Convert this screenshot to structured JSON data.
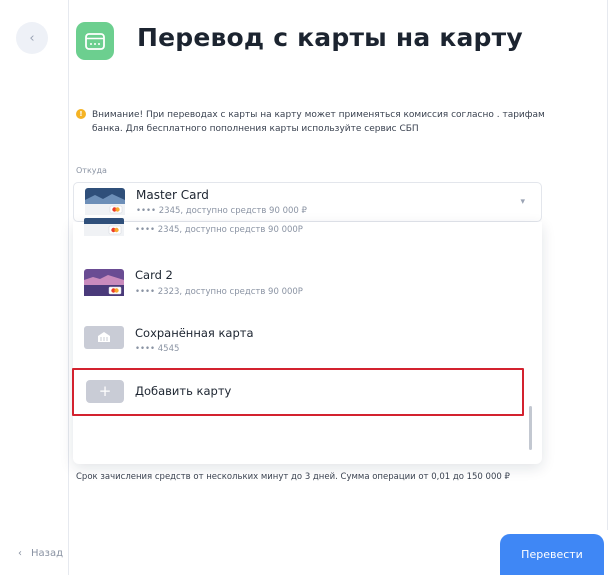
{
  "header": {
    "title": "Перевод с карты на карту",
    "back_icon": "chevron-left-icon",
    "title_icon": "wallet-icon"
  },
  "notice": {
    "text": "Внимание! При переводах с карты на карту может применяться комиссия согласно . тарифам банка. Для бесплатного пополнения карты используйте сервис СБП"
  },
  "from": {
    "label": "Откуда",
    "selected": {
      "title": "Master Card",
      "subtitle": "•••• 2345, доступно средств 90 000 ₽"
    }
  },
  "dropdown": {
    "items": [
      {
        "title": "",
        "subtitle": "•••• 2345, доступно средств 90 000Р",
        "card_style": "mastercard-blue"
      },
      {
        "title": "Card 2",
        "subtitle": "•••• 2323, доступно средств 90 000Р",
        "card_style": "mastercard-purple"
      },
      {
        "title": "Сохранённая карта",
        "subtitle": "•••• 4545",
        "card_style": "saved-gray"
      }
    ],
    "add_card_label": "Добавить карту",
    "add_card_symbol": "+"
  },
  "footnote": "Срок зачисления средств от нескольких минут до 3 дней. Сумма операции от 0,01 до 150 000 ₽",
  "footer": {
    "back_label": "Назад",
    "submit_label": "Перевести"
  },
  "colors": {
    "accent": "#3f87f5",
    "title_icon_bg": "#6ccf8f",
    "highlight": "#d3222f",
    "warning": "#f5b324"
  }
}
